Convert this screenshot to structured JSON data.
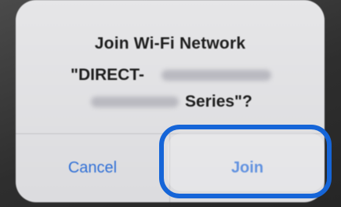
{
  "dialog": {
    "title": "Join Wi-Fi Network",
    "ssid_prefix": "\"DIRECT-",
    "ssid_suffix": "Series\"?",
    "cancel_label": "Cancel",
    "join_label": "Join"
  },
  "colors": {
    "accent": "#2f6fd6",
    "highlight_outline": "#1565d8",
    "dialog_background": "#e1e1e4"
  }
}
